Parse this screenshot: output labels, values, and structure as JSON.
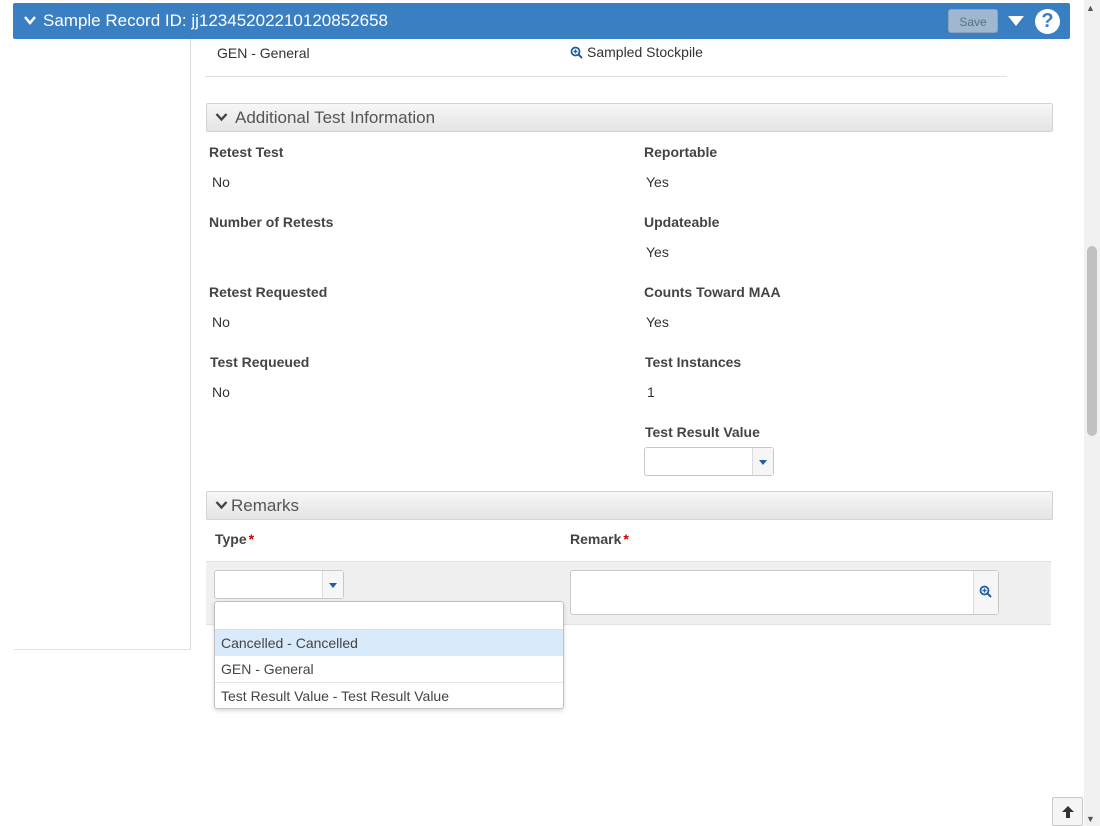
{
  "header": {
    "title": "Sample Record ID: jj12345202210120852658",
    "save_label": "Save",
    "help_label": "?"
  },
  "top_row": {
    "left_value": "GEN - General",
    "right_value": "Sampled Stockpile"
  },
  "additional": {
    "header": "Additional Test Information",
    "fields": [
      {
        "label": "Retest Test",
        "value": "No"
      },
      {
        "label": "Reportable",
        "value": "Yes"
      },
      {
        "label": "Number of Retests",
        "value": ""
      },
      {
        "label": "Updateable",
        "value": "Yes"
      },
      {
        "label": "Retest Requested",
        "value": "No"
      },
      {
        "label": "Counts Toward MAA",
        "value": "Yes"
      },
      {
        "label": "Test Requeued",
        "value": "No"
      },
      {
        "label": "Test Instances",
        "value": "1"
      },
      {
        "label": "Test Result Value",
        "value": ""
      }
    ]
  },
  "remarks": {
    "header": "Remarks",
    "type_label": "Type",
    "remark_label": "Remark",
    "required_marker": "*",
    "type_value": "",
    "remark_value": "",
    "dropdown_filter": "",
    "dropdown_options": [
      "Cancelled - Cancelled",
      "GEN - General",
      "Test Result Value - Test Result Value"
    ]
  },
  "colors": {
    "header_bg": "#3a7fc1",
    "required": "#cc0000",
    "highlight": "#d9eafa"
  },
  "icons": [
    "chevron-down-icon",
    "caret-down-icon",
    "help-icon",
    "zoom-icon",
    "arrow-up-icon"
  ]
}
